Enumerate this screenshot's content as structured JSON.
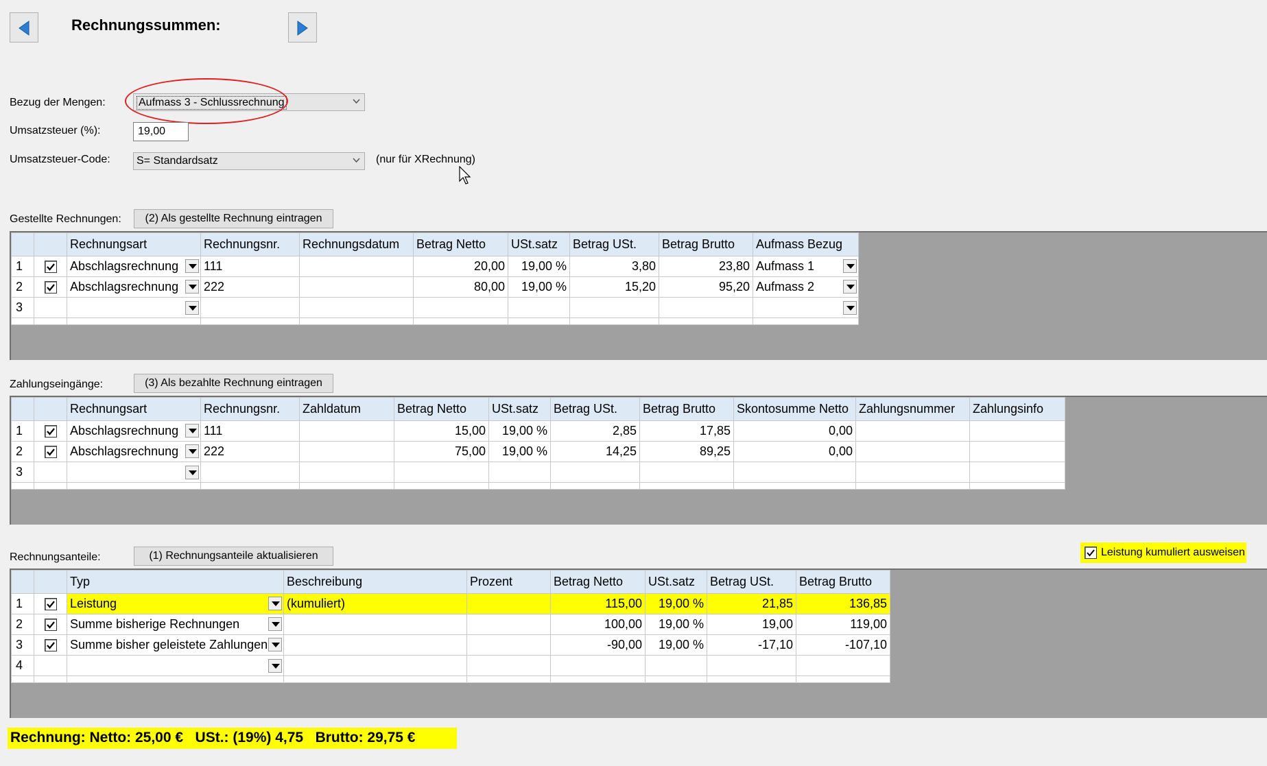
{
  "header": {
    "title": "Rechnungssummen:"
  },
  "settings": {
    "bezug_label": "Bezug der Mengen:",
    "bezug_value": "Aufmass 3 - Schlussrechnung",
    "ust_label": "Umsatzsteuer (%):",
    "ust_value": "19,00",
    "ustcode_label": "Umsatzsteuer-Code:",
    "ustcode_value": "S= Standardsatz",
    "ustcode_note": "(nur für XRechnung)"
  },
  "gestellte": {
    "label": "Gestellte Rechnungen:",
    "button": "(2) Als gestellte Rechnung eintragen",
    "columns": [
      "Rechnungsart",
      "Rechnungsnr.",
      "Rechnungsdatum",
      "Betrag Netto",
      "USt.satz",
      "Betrag USt.",
      "Betrag Brutto",
      "Aufmass Bezug"
    ],
    "rows": [
      {
        "n": "1",
        "checked": true,
        "art": "Abschlagsrechnung",
        "nr": "111",
        "datum": "",
        "netto": "20,00",
        "satz": "19,00 %",
        "ust": "3,80",
        "brutto": "23,80",
        "bezug": "Aufmass 1"
      },
      {
        "n": "2",
        "checked": true,
        "art": "Abschlagsrechnung",
        "nr": "222",
        "datum": "",
        "netto": "80,00",
        "satz": "19,00 %",
        "ust": "15,20",
        "brutto": "95,20",
        "bezug": "Aufmass 2"
      },
      {
        "n": "3",
        "checked": false,
        "art": "",
        "nr": "",
        "datum": "",
        "netto": "",
        "satz": "",
        "ust": "",
        "brutto": "",
        "bezug": ""
      }
    ]
  },
  "zahlungen": {
    "label": "Zahlungseingänge:",
    "button": "(3) Als bezahlte Rechnung eintragen",
    "columns": [
      "Rechnungsart",
      "Rechnungsnr.",
      "Zahldatum",
      "Betrag Netto",
      "USt.satz",
      "Betrag USt.",
      "Betrag Brutto",
      "Skontosumme Netto",
      "Zahlungsnummer",
      "Zahlungsinfo"
    ],
    "rows": [
      {
        "n": "1",
        "checked": true,
        "art": "Abschlagsrechnung",
        "nr": "111",
        "datum": "",
        "netto": "15,00",
        "satz": "19,00 %",
        "ust": "2,85",
        "brutto": "17,85",
        "skonto": "0,00",
        "znr": "",
        "zinfo": ""
      },
      {
        "n": "2",
        "checked": true,
        "art": "Abschlagsrechnung",
        "nr": "222",
        "datum": "",
        "netto": "75,00",
        "satz": "19,00 %",
        "ust": "14,25",
        "brutto": "89,25",
        "skonto": "0,00",
        "znr": "",
        "zinfo": ""
      },
      {
        "n": "3",
        "checked": false,
        "art": "",
        "nr": "",
        "datum": "",
        "netto": "",
        "satz": "",
        "ust": "",
        "brutto": "",
        "skonto": "",
        "znr": "",
        "zinfo": ""
      }
    ]
  },
  "anteile": {
    "label": "Rechnungsanteile:",
    "button": "(1) Rechnungsanteile aktualisieren",
    "kumuliert_label": "Leistung kumuliert ausweisen",
    "columns": [
      "Typ",
      "Beschreibung",
      "Prozent",
      "Betrag Netto",
      "USt.satz",
      "Betrag USt.",
      "Betrag Brutto"
    ],
    "rows": [
      {
        "n": "1",
        "checked": true,
        "typ": "Leistung",
        "beschr": "(kumuliert)",
        "prozent": "",
        "netto": "115,00",
        "satz": "19,00 %",
        "ust": "21,85",
        "brutto": "136,85",
        "highlight": true
      },
      {
        "n": "2",
        "checked": true,
        "typ": "Summe bisherige Rechnungen",
        "beschr": "",
        "prozent": "",
        "netto": "100,00",
        "satz": "19,00 %",
        "ust": "19,00",
        "brutto": "119,00",
        "highlight": false
      },
      {
        "n": "3",
        "checked": true,
        "typ": "Summe bisher geleistete Zahlungen",
        "beschr": "",
        "prozent": "",
        "netto": "-90,00",
        "satz": "19,00 %",
        "ust": "-17,10",
        "brutto": "-107,10",
        "highlight": false
      },
      {
        "n": "4",
        "checked": false,
        "typ": "",
        "beschr": "",
        "prozent": "",
        "netto": "",
        "satz": "",
        "ust": "",
        "brutto": "",
        "highlight": false
      }
    ]
  },
  "summary": "Rechnung: Netto: 25,00 €   USt.: (19%) 4,75   Brutto: 29,75 €",
  "colors": {
    "highlight": "#ffff00",
    "annotation": "#e02020",
    "header_bg": "#dde9f5"
  }
}
